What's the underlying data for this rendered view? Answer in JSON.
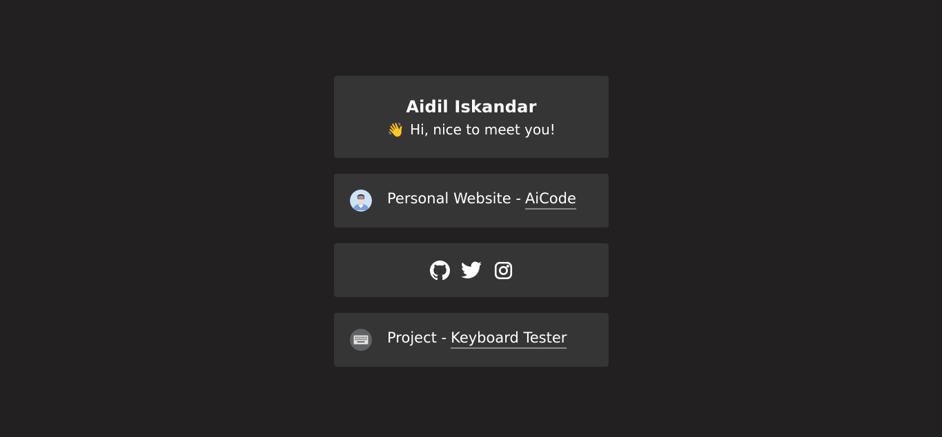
{
  "profile": {
    "name": "Aidil Iskandar",
    "wave_emoji": "👋",
    "greeting": "Hi, nice to meet you!"
  },
  "links": {
    "website": {
      "prefix": "Personal Website -",
      "anchor": "AiCode",
      "icon": "avatar-icon"
    },
    "project": {
      "prefix": "Project -",
      "anchor": "Keyboard Tester",
      "icon": "keyboard-icon"
    }
  },
  "social": {
    "icons": [
      "github-icon",
      "twitter-icon",
      "instagram-icon"
    ]
  },
  "colors": {
    "background": "#222021",
    "card": "#353535",
    "text": "#ffffff",
    "underline": "#8a8a8a"
  }
}
